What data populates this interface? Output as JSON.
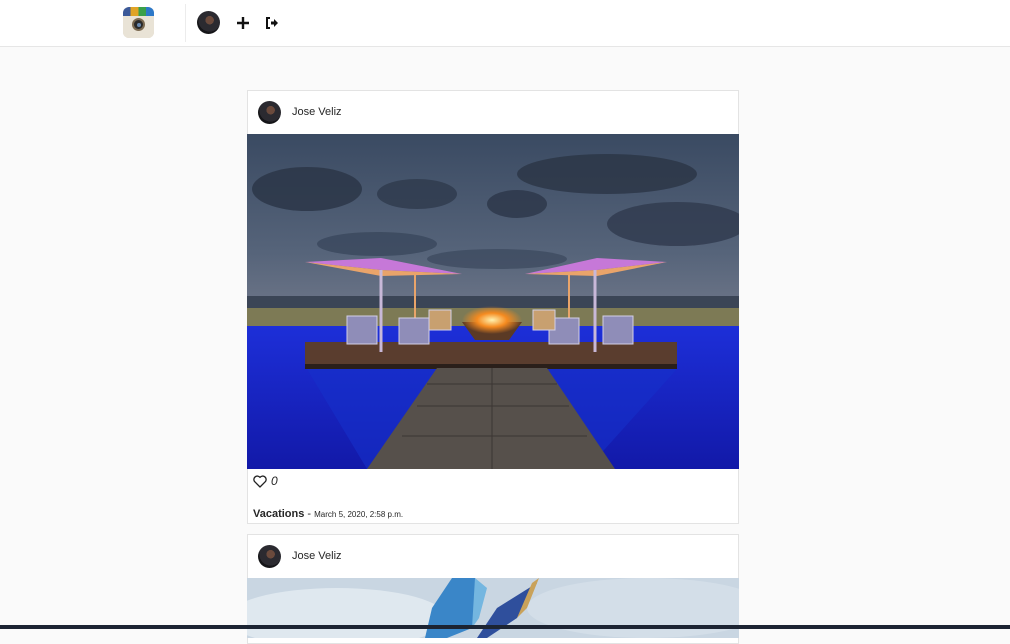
{
  "app": {
    "name": "Instagram",
    "accent": "#262626"
  },
  "navbar": {
    "logo_icon": "instagram-camera-icon",
    "avatar_icon": "user-avatar",
    "add_icon": "plus-icon",
    "logout_icon": "logout-icon"
  },
  "posts": [
    {
      "username": "Jose Veliz",
      "likes": "0",
      "album": "Vacations",
      "separator": " - ",
      "date": "March 5, 2020, 2:58 p.m."
    },
    {
      "username": "Jose Veliz"
    }
  ]
}
